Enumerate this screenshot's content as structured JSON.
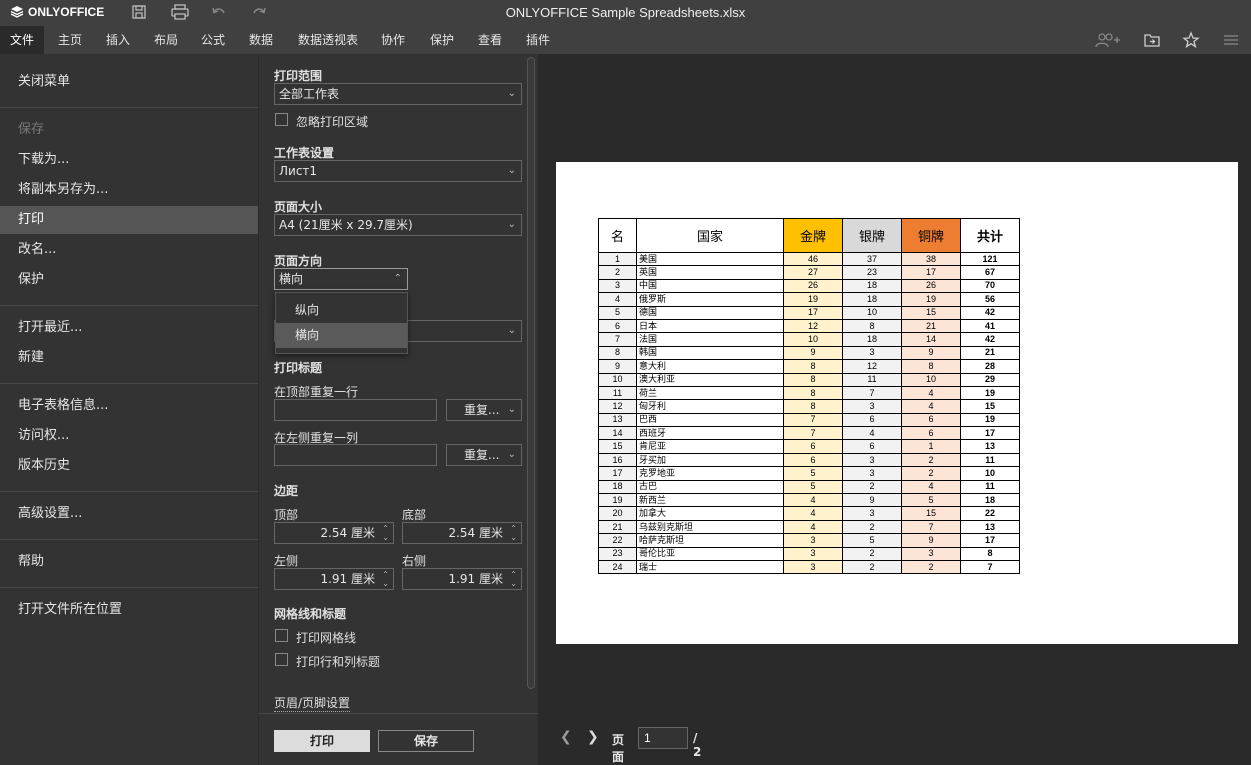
{
  "app": {
    "brand": "ONLYOFFICE",
    "document_title": "ONLYOFFICE Sample Spreadsheets.xlsx"
  },
  "titlebar_icons": [
    "save-icon",
    "print-icon",
    "undo-icon",
    "redo-icon"
  ],
  "menu": {
    "tabs": [
      "文件",
      "主页",
      "插入",
      "布局",
      "公式",
      "数据",
      "数据透视表",
      "协作",
      "保护",
      "查看",
      "插件"
    ],
    "active_index": 0,
    "right_icons": [
      "add-user-icon",
      "open-location-icon",
      "favorite-star-icon",
      "hamburger-menu-icon"
    ]
  },
  "sidebar": {
    "items": [
      {
        "label": "关闭菜单"
      },
      {
        "label": "保存",
        "disabled": true
      },
      {
        "label": "下载为..."
      },
      {
        "label": "将副本另存为..."
      },
      {
        "label": "打印",
        "active": true
      },
      {
        "label": "改名..."
      },
      {
        "label": "保护"
      },
      {
        "label": "打开最近..."
      },
      {
        "label": "新建"
      },
      {
        "label": "电子表格信息..."
      },
      {
        "label": "访问权..."
      },
      {
        "label": "版本历史"
      },
      {
        "label": "高级设置..."
      },
      {
        "label": "帮助"
      },
      {
        "label": "打开文件所在位置"
      }
    ]
  },
  "print_settings": {
    "print_range": {
      "label": "打印范围",
      "value": "全部工作表"
    },
    "ignore_print_area": {
      "label": "忽略打印区域",
      "checked": false
    },
    "sheet_settings": {
      "label": "工作表设置",
      "value": "Лист1"
    },
    "page_size": {
      "label": "页面大小",
      "value": "A4 (21厘米 x 29.7厘米)"
    },
    "page_orientation": {
      "label": "页面方向",
      "value": "横向",
      "options": [
        "纵向",
        "横向"
      ]
    },
    "print_titles": {
      "label": "打印标题",
      "repeat_rows_label": "在顶部重复一行",
      "repeat_rows_button": "重复...",
      "repeat_cols_label": "在左侧重复一列",
      "repeat_cols_button": "重复..."
    },
    "margins": {
      "label": "边距",
      "top_label": "顶部",
      "top_value": "2.54 厘米",
      "bottom_label": "底部",
      "bottom_value": "2.54 厘米",
      "left_label": "左侧",
      "left_value": "1.91 厘米",
      "right_label": "右侧",
      "right_value": "1.91 厘米"
    },
    "gridlines": {
      "label": "网格线和标题",
      "print_gridlines": "打印网格线",
      "print_headings": "打印行和列标题"
    },
    "header_footer_link": "页眉/页脚设置",
    "print_button": "打印",
    "save_button": "保存"
  },
  "preview": {
    "table": {
      "headers": [
        "名",
        "国家",
        "金牌",
        "银牌",
        "铜牌",
        "共计"
      ],
      "header_colors": {
        "gold": "#FFC000",
        "silver": "#D9D9D9",
        "bronze": "#ED7D31"
      },
      "cell_tints": {
        "gold": "#FFF2CC",
        "silver": "#F2F2F2",
        "bronze": "#FCE4D6"
      },
      "rows": [
        [
          "1",
          "美国",
          "46",
          "37",
          "38",
          "121"
        ],
        [
          "2",
          "英国",
          "27",
          "23",
          "17",
          "67"
        ],
        [
          "3",
          "中国",
          "26",
          "18",
          "26",
          "70"
        ],
        [
          "4",
          "俄罗斯",
          "19",
          "18",
          "19",
          "56"
        ],
        [
          "5",
          "德国",
          "17",
          "10",
          "15",
          "42"
        ],
        [
          "6",
          "日本",
          "12",
          "8",
          "21",
          "41"
        ],
        [
          "7",
          "法国",
          "10",
          "18",
          "14",
          "42"
        ],
        [
          "8",
          "韩国",
          "9",
          "3",
          "9",
          "21"
        ],
        [
          "9",
          "意大利",
          "8",
          "12",
          "8",
          "28"
        ],
        [
          "10",
          "澳大利亚",
          "8",
          "11",
          "10",
          "29"
        ],
        [
          "11",
          "荷兰",
          "8",
          "7",
          "4",
          "19"
        ],
        [
          "12",
          "匈牙利",
          "8",
          "3",
          "4",
          "15"
        ],
        [
          "13",
          "巴西",
          "7",
          "6",
          "6",
          "19"
        ],
        [
          "14",
          "西班牙",
          "7",
          "4",
          "6",
          "17"
        ],
        [
          "15",
          "肯尼亚",
          "6",
          "6",
          "1",
          "13"
        ],
        [
          "16",
          "牙买加",
          "6",
          "3",
          "2",
          "11"
        ],
        [
          "17",
          "克罗地亚",
          "5",
          "3",
          "2",
          "10"
        ],
        [
          "18",
          "古巴",
          "5",
          "2",
          "4",
          "11"
        ],
        [
          "19",
          "新西兰",
          "4",
          "9",
          "5",
          "18"
        ],
        [
          "20",
          "加拿大",
          "4",
          "3",
          "15",
          "22"
        ],
        [
          "21",
          "乌兹别克斯坦",
          "4",
          "2",
          "7",
          "13"
        ],
        [
          "22",
          "哈萨克斯坦",
          "3",
          "5",
          "9",
          "17"
        ],
        [
          "23",
          "哥伦比亚",
          "3",
          "2",
          "3",
          "8"
        ],
        [
          "24",
          "瑞士",
          "3",
          "2",
          "2",
          "7"
        ]
      ]
    },
    "pager": {
      "label": "页面",
      "current": "1",
      "total": "/ 2"
    }
  }
}
